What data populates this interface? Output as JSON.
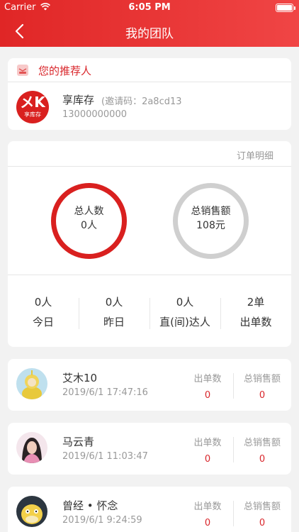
{
  "status_bar": {
    "carrier": "Carrier",
    "time": "6:05 PM"
  },
  "nav": {
    "title": "我的团队",
    "back_icon": "chevron-left-icon"
  },
  "referrer": {
    "section_title": "您的推荐人",
    "section_icon": "referrer-card-icon",
    "logo_mark": "メK",
    "logo_sub": "享库存",
    "name": "享库存",
    "invite_code": "(邀请码：2a8cd13",
    "phone": "13000000000"
  },
  "stats": {
    "order_detail_link": "订单明细",
    "total_people": {
      "label": "总人数",
      "value": "0人"
    },
    "total_sales": {
      "label": "总销售额",
      "value": "108元"
    },
    "cells": [
      {
        "value": "0人",
        "label": "今日"
      },
      {
        "value": "0人",
        "label": "昨日"
      },
      {
        "value": "0人",
        "label": "直(间)达人"
      },
      {
        "value": "2单",
        "label": "出单数"
      }
    ]
  },
  "members": [
    {
      "name": "艾木10",
      "date": "2019/6/1 17:47:16",
      "orders_label": "出单数",
      "orders": "0",
      "sales_label": "总销售额",
      "sales": "0"
    },
    {
      "name": "马云青",
      "date": "2019/6/1 11:03:47",
      "orders_label": "出单数",
      "orders": "0",
      "sales_label": "总销售额",
      "sales": "0"
    },
    {
      "name": "曾经 • 怀念",
      "date": "2019/6/1 9:24:59",
      "orders_label": "出单数",
      "orders": "0",
      "sales_label": "总销售额",
      "sales": "0"
    }
  ],
  "colors": {
    "brand_red": "#e02626",
    "ring_gray": "#cfcfcf",
    "value_red": "#d9262b"
  }
}
